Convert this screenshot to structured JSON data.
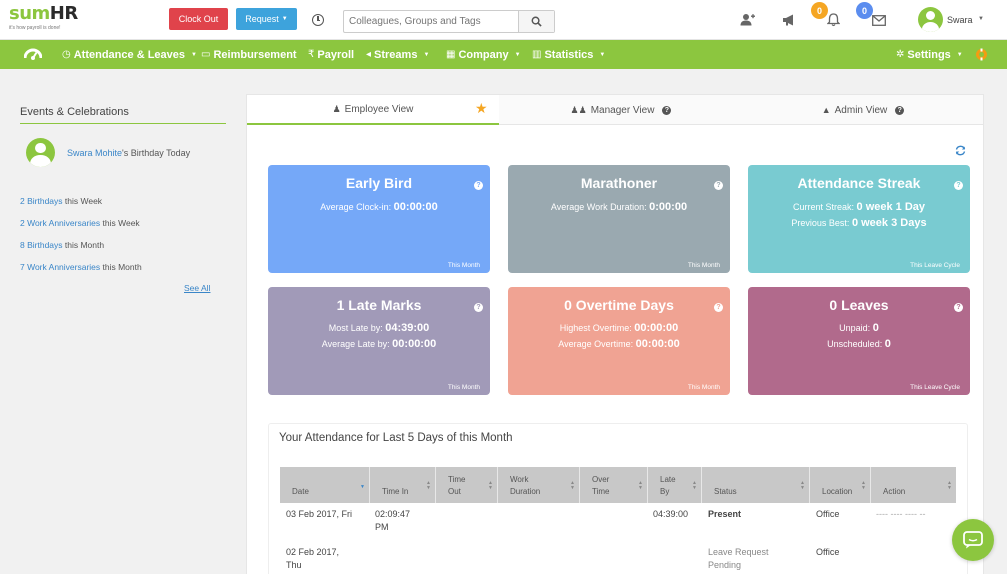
{
  "brand": {
    "logo_a": "sum",
    "logo_b": "HR",
    "tagline": "it's how payroll is done!"
  },
  "header": {
    "clock_out": "Clock Out",
    "request": "Request",
    "search_placeholder": "Colleagues, Groups and Tags",
    "badges": {
      "notifications": "0",
      "messages": "0"
    },
    "user_name": "Swara",
    "colors": {
      "clock_out": "#e0434b",
      "request": "#3da3dc",
      "badge_orange": "#f5a623",
      "badge_blue": "#5b8def"
    }
  },
  "nav": {
    "items": [
      {
        "label": "Attendance & Leaves",
        "icon": "clock-icon"
      },
      {
        "label": "Reimbursement",
        "icon": "money-icon"
      },
      {
        "label": "Payroll",
        "icon": "rupee-icon"
      },
      {
        "label": "Streams",
        "icon": "bullhorn-icon"
      },
      {
        "label": "Company",
        "icon": "building-icon"
      },
      {
        "label": "Statistics",
        "icon": "bar-chart-icon"
      }
    ],
    "settings": "Settings",
    "accent": "#8cc63f"
  },
  "events": {
    "title": "Events & Celebrations",
    "birthday_name": "Swara Mohite",
    "birthday_suffix": "'s Birthday Today",
    "lines": [
      {
        "link": "2 Birthdays",
        "rest": " this Week"
      },
      {
        "link": "2 Work Anniversaries",
        "rest": " this Week"
      },
      {
        "link": "8 Birthdays",
        "rest": " this Month"
      },
      {
        "link": "7 Work Anniversaries",
        "rest": " this Month"
      }
    ],
    "see_all": "See All"
  },
  "tabs": {
    "employee": "Employee View",
    "manager": "Manager View",
    "admin": "Admin View"
  },
  "cards": [
    {
      "title": "Early Bird",
      "lines": [
        {
          "label": "Average Clock-in:",
          "value": "00:00:00"
        }
      ],
      "footer": "This Month",
      "color": "#75a8f8"
    },
    {
      "title": "Marathoner",
      "lines": [
        {
          "label": "Average Work Duration:",
          "value": "0:00:00"
        }
      ],
      "footer": "This Month",
      "color": "#9aa9b0"
    },
    {
      "title": "Attendance Streak",
      "lines": [
        {
          "label": "Current Streak:",
          "value": "0 week 1 Day"
        },
        {
          "label": "Previous Best:",
          "value": "0 week 3 Days"
        }
      ],
      "footer": "This Leave Cycle",
      "color": "#79cbd1"
    },
    {
      "title": "1 Late Marks",
      "lines": [
        {
          "label": "Most Late by:",
          "value": "04:39:00"
        },
        {
          "label": "Average Late by:",
          "value": "00:00:00"
        }
      ],
      "footer": "This Month",
      "color": "#a19ab8"
    },
    {
      "title": "0 Overtime Days",
      "lines": [
        {
          "label": "Highest Overtime:",
          "value": "00:00:00"
        },
        {
          "label": "Average Overtime:",
          "value": "00:00:00"
        }
      ],
      "footer": "This Month",
      "color": "#f0a393"
    },
    {
      "title": "0 Leaves",
      "lines": [
        {
          "label": "Unpaid:",
          "value": "0"
        },
        {
          "label": "Unscheduled:",
          "value": "0"
        }
      ],
      "footer": "This Leave Cycle",
      "color": "#b16a8c"
    }
  ],
  "attendance": {
    "title": "Your Attendance for Last 5 Days of this Month",
    "columns": [
      "Date",
      "Time In",
      "Time Out",
      "Work Duration",
      "Over Time",
      "Late By",
      "Status",
      "Location",
      "Action"
    ],
    "rows": [
      {
        "date": "03 Feb 2017, Fri",
        "time_in": "02:09:47 PM",
        "time_out": "",
        "work_duration": "",
        "over_time": "",
        "late_by": "04:39:00",
        "status": "Present",
        "location": "Office",
        "action": "---- ---- ---- --"
      },
      {
        "date": "02 Feb 2017, Thu",
        "time_in": "",
        "time_out": "",
        "work_duration": "",
        "over_time": "",
        "late_by": "",
        "status": "Leave Request Pending",
        "location": "Office",
        "action": ""
      }
    ]
  }
}
